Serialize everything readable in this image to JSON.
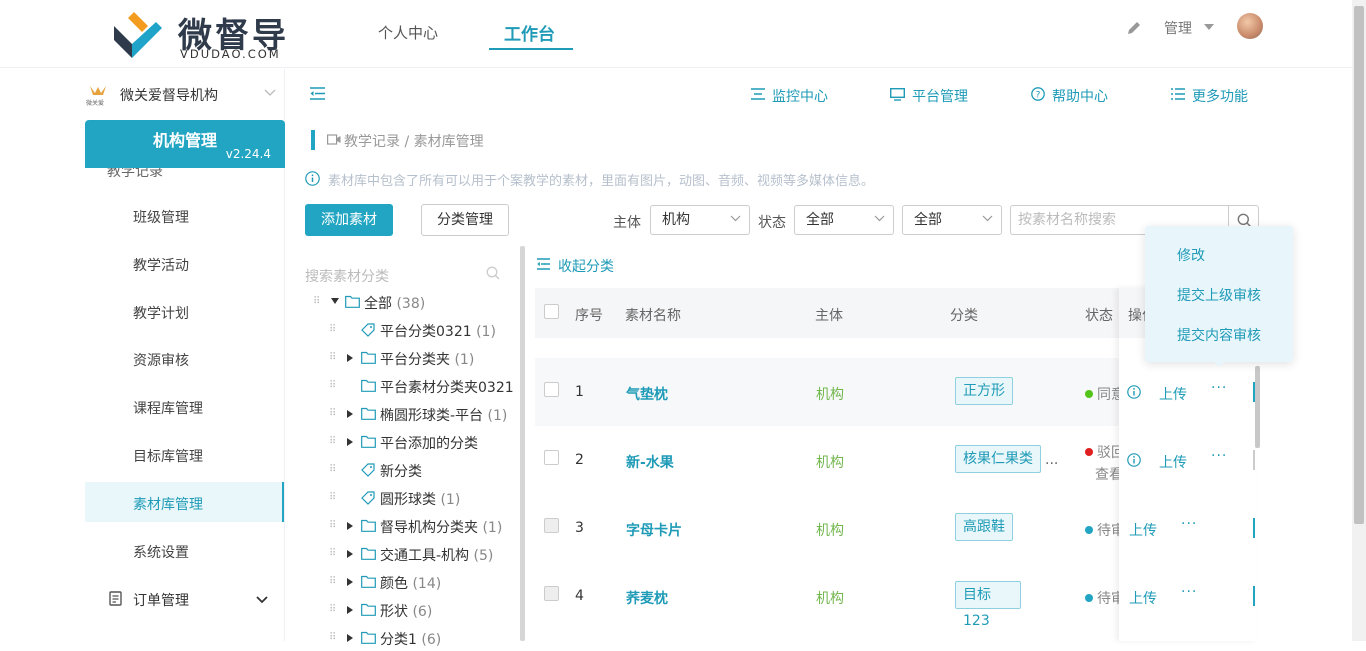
{
  "header": {
    "logo_text": "微督导",
    "logo_sub": "VDUDAO.COM",
    "nav": [
      "个人中心",
      "工作台"
    ],
    "user_label": "管理"
  },
  "sidebar": {
    "org_name": "微关爱督导机构",
    "org_logo_text": "微关爱",
    "block_title": "机构管理",
    "version": "v2.24.4",
    "partial_item": "教学记录",
    "items": [
      "班级管理",
      "教学活动",
      "教学计划",
      "资源审核",
      "课程库管理",
      "目标库管理",
      "素材库管理",
      "系统设置"
    ],
    "order_mgmt": "订单管理"
  },
  "tools": [
    "监控中心",
    "平台管理",
    "帮助中心",
    "更多功能"
  ],
  "breadcrumb": "教学记录 / 素材库管理",
  "info_text": "素材库中包含了所有可以用于个案教学的素材，里面有图片，动图、音频、视频等多媒体信息。",
  "actions": {
    "add": "添加素材",
    "category": "分类管理"
  },
  "filters": {
    "subject_label": "主体",
    "subject_value": "机构",
    "status_label": "状态",
    "status_value": "全部",
    "type_value": "全部",
    "search_placeholder": "按素材名称搜索"
  },
  "tree": {
    "search_placeholder": "搜索素材分类",
    "nodes": [
      {
        "label": "全部",
        "count": "(38)"
      },
      {
        "label": "平台分类0321",
        "count": "(1)"
      },
      {
        "label": "平台分类夹",
        "count": "(1)"
      },
      {
        "label": "平台素材分类夹0321",
        "count": ""
      },
      {
        "label": "椭圆形球类-平台",
        "count": "(1)"
      },
      {
        "label": "平台添加的分类",
        "count": ""
      },
      {
        "label": "新分类",
        "count": ""
      },
      {
        "label": "圆形球类",
        "count": "(1)"
      },
      {
        "label": "督导机构分类夹",
        "count": "(1)"
      },
      {
        "label": "交通工具-机构",
        "count": "(5)"
      },
      {
        "label": "颜色",
        "count": "(14)"
      },
      {
        "label": "形状",
        "count": "(6)"
      },
      {
        "label": "分类1",
        "count": "(6)"
      }
    ]
  },
  "table": {
    "collapse_label": "收起分类",
    "headers": [
      "序号",
      "素材名称",
      "主体",
      "分类",
      "状态",
      "操作"
    ],
    "rows": [
      {
        "num": "1",
        "name": "气垫枕",
        "subject": "机构",
        "category": "正方形",
        "status": "同意",
        "upload": "上传"
      },
      {
        "num": "2",
        "name": "新-水果",
        "subject": "机构",
        "category": "核果仁果类",
        "status": "驳回",
        "status_sub": "查看",
        "upload": "上传"
      },
      {
        "num": "3",
        "name": "字母卡片",
        "subject": "机构",
        "category": "高跟鞋",
        "status": "待审",
        "upload": "上传"
      },
      {
        "num": "4",
        "name": "荞麦枕",
        "subject": "机构",
        "category": "目标123",
        "status": "待审",
        "upload": "上传"
      }
    ],
    "more": "···",
    "ellipsis": "..."
  },
  "popup": [
    "修改",
    "提交上级审核",
    "提交内容审核"
  ],
  "colors": {
    "accent": "#21a5c2",
    "success": "#52c41a",
    "danger": "#e02020"
  }
}
